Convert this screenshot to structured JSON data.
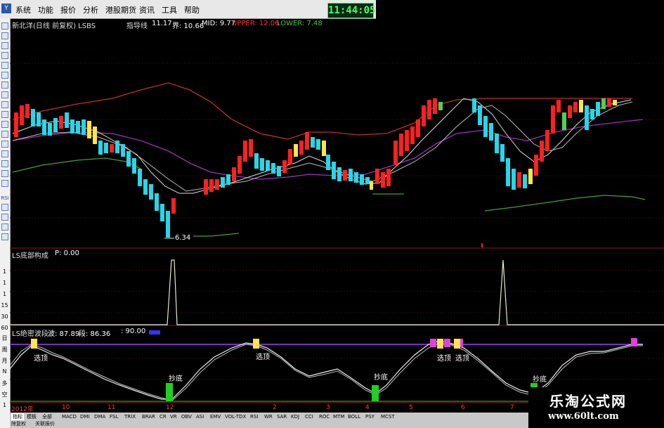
{
  "menu": {
    "logo": "Y",
    "items": [
      "系统",
      "功能",
      "报价",
      "分析",
      "港股期货",
      "资讯",
      "工具",
      "帮助"
    ]
  },
  "clock": "11:44:05",
  "main_panel": {
    "title": "新北洋(日线 前复权) LSBS",
    "indicator_name": "指导线",
    "indicator_value": "11.17",
    "jie": "界: 10.66",
    "mid": "MID: 9.77",
    "upper": "UPPER: 12.06",
    "lower": "LOWER: 7.48",
    "low_price": "6.34"
  },
  "panel2": {
    "title": "LS底部构成",
    "p": "P: 0.00",
    "y_labels": [
      "1",
      "1",
      "1",
      "15",
      "30",
      "60"
    ]
  },
  "panel3": {
    "title": "LS绝密波段",
    "bo": "波: 87.89",
    "duan": "段: 86.36",
    "level": ": 90.00",
    "side_labels": [
      "日",
      "周",
      "月",
      "N",
      "多",
      "空",
      "1"
    ],
    "annotations": [
      "选顶",
      "抄底",
      "选顶",
      "抄底",
      "选顶",
      "选顶",
      "抄底"
    ]
  },
  "x_axis": [
    "2012年",
    "10",
    "11",
    "12",
    "2",
    "3",
    "4",
    "5",
    "6",
    "7"
  ],
  "bottom_tabs": [
    "指标",
    "模板",
    "全部",
    "MACD",
    "DMI",
    "DMA",
    "FSL",
    "TRIX",
    "BRAR",
    "CR",
    "VR",
    "OBV",
    "ASI",
    "EMV",
    "VOL-TDX",
    "RSI",
    "WR",
    "SAR",
    "KDJ",
    "CCI",
    "ROC",
    "MTM",
    "BOLL",
    "PSY",
    "MCST"
  ],
  "bottom_tabs_2": [
    "除复权",
    "关联报价"
  ],
  "toolbar_labels": [
    "RSI"
  ],
  "colors": {
    "up": "#ff2020",
    "down": "#27d6e8",
    "upper_band": "#c03030",
    "mid_band": "#a030c0",
    "lower_band": "#40a040",
    "clock_text": "#44ff66"
  },
  "watermark": {
    "title": "乐淘公式网",
    "url": "www.60lt.com"
  }
}
